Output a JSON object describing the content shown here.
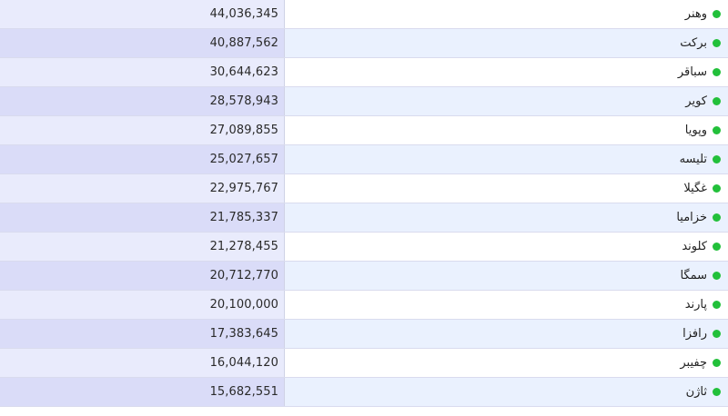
{
  "status_color": "#22c03a",
  "rows": [
    {
      "name": "وهنر",
      "value": "44,036,345"
    },
    {
      "name": "برکت",
      "value": "40,887,562"
    },
    {
      "name": "سباقر",
      "value": "30,644,623"
    },
    {
      "name": "کویر",
      "value": "28,578,943"
    },
    {
      "name": "وپویا",
      "value": "27,089,855"
    },
    {
      "name": "تلیسه",
      "value": "25,027,657"
    },
    {
      "name": "غگیلا",
      "value": "22,975,767"
    },
    {
      "name": "خزامیا",
      "value": "21,785,337"
    },
    {
      "name": "کلوند",
      "value": "21,278,455"
    },
    {
      "name": "سمگا",
      "value": "20,712,770"
    },
    {
      "name": "پارند",
      "value": "20,100,000"
    },
    {
      "name": "رافزا",
      "value": "17,383,645"
    },
    {
      "name": "چفیبر",
      "value": "16,044,120"
    },
    {
      "name": "ثاژن",
      "value": "15,682,551"
    }
  ]
}
